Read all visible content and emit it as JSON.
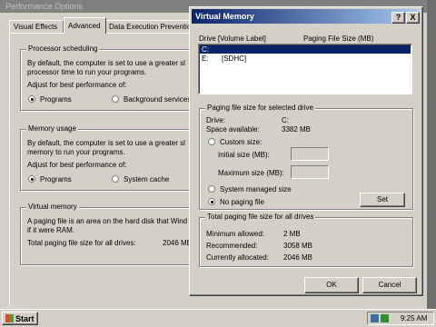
{
  "perf": {
    "title": "Performance Options",
    "tabs": [
      "Visual Effects",
      "Advanced",
      "Data Execution Preventio"
    ],
    "processor": {
      "heading": "Processor scheduling",
      "desc1": "By default, the computer is set to use a greater sl",
      "desc2": "processor time to run your programs.",
      "adjust": "Adjust for best performance of:",
      "opt1": "Programs",
      "opt2": "Background services"
    },
    "memory": {
      "heading": "Memory usage",
      "desc1": "By default, the computer is set to use a greater sl",
      "desc2": "memory to run your programs.",
      "adjust": "Adjust for best performance of:",
      "opt1": "Programs",
      "opt2": "System cache"
    },
    "virtual": {
      "heading": "Virtual memory",
      "desc1": "A paging file is an area on the hard disk that Wind",
      "desc2": "if it were RAM.",
      "total_label": "Total paging file size for all drives:",
      "total_value": "2046 MB"
    }
  },
  "vm": {
    "title": "Virtual Memory",
    "help_btn": "?",
    "close_btn": "X",
    "col_drive": "Drive  [Volume Label]",
    "col_size": "Paging File Size (MB)",
    "drives": [
      {
        "drive": "C:",
        "label": ""
      },
      {
        "drive": "E:",
        "label": "[SDHC]"
      }
    ],
    "selected": {
      "heading": "Paging file size for selected drive",
      "drive_label": "Drive:",
      "drive_value": "C:",
      "space_label": "Space available:",
      "space_value": "3382 MB",
      "custom": "Custom size:",
      "initial": "Initial size (MB):",
      "maximum": "Maximum size (MB):",
      "system_managed": "System managed size",
      "no_paging": "No paging file",
      "set": "Set"
    },
    "total": {
      "heading": "Total paging file size for all drives",
      "min_label": "Minimum allowed:",
      "min_value": "2 MB",
      "rec_label": "Recommended:",
      "rec_value": "3058 MB",
      "cur_label": "Currently allocated:",
      "cur_value": "2046 MB"
    },
    "ok": "OK",
    "cancel": "Cancel"
  },
  "taskbar": {
    "start": "Start",
    "time": "9:25 AM"
  }
}
